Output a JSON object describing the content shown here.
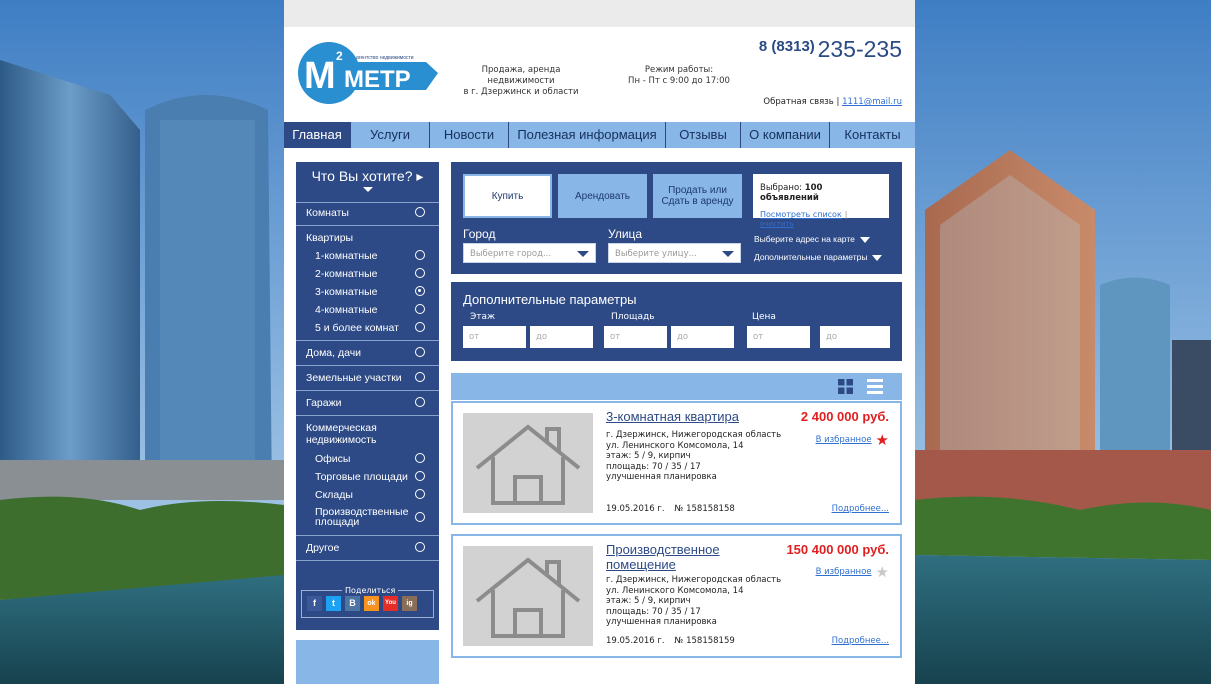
{
  "header": {
    "logo_text": "МЕТР",
    "logo_sup": "2",
    "logo_caption": "агентство недвижимости",
    "tagline": [
      "Продажа, аренда недвижимости",
      "в г. Дзержинск и области"
    ],
    "hours": [
      "Режим работы:",
      "Пн - Пт с 9:00 до 17:00"
    ],
    "phone_code": "8 (8313)",
    "phone_number": "235-235",
    "feedback_label": "Обратная связь |",
    "feedback_email": "1111@mail.ru"
  },
  "nav": {
    "items": [
      "Главная",
      "Услуги",
      "Новости",
      "Полезная информация",
      "Отзывы",
      "О компании",
      "Контакты"
    ],
    "active": "Главная"
  },
  "sidebar": {
    "title": "Что Вы хотите?",
    "komnaty": "Комнаты",
    "kvartiry": "Квартиры",
    "k1": "1-комнатные",
    "k2": "2-комнатные",
    "k3": "3-комнатные",
    "k4": "4-комнатные",
    "k5": "5 и более комнат",
    "doma": "Дома, дачи",
    "zemlya": "Земельные участки",
    "garazhi": "Гаражи",
    "kommercheskaya": "Коммерческая недвижимость",
    "ofisy": "Офисы",
    "torg": "Торговые площади",
    "sklady": "Склады",
    "proizv": "Производственные площади",
    "drugoe": "Другое",
    "selected": "3-комнатные",
    "share_label": "Поделиться",
    "social": [
      "f",
      "t",
      "B",
      "ok",
      "You",
      "ig"
    ]
  },
  "search": {
    "buy": "Купить",
    "rent": "Арендовать",
    "sell": "Продать или Сдать в аренду",
    "selected_prefix": "Выбрано: ",
    "selected_count": "100 объявлений",
    "view_list": "Посмотреть список",
    "clear": "очистить",
    "city_label": "Город",
    "city_placeholder": "Выберите город...",
    "street_label": "Улица",
    "street_placeholder": "Выберите улицу...",
    "map_link": "Выберите адрес на карте",
    "more_params_link": "Дополнительные параметры"
  },
  "params": {
    "title": "Дополнительные параметры",
    "floor": "Этаж",
    "area": "Площадь",
    "price": "Цена",
    "from": "от",
    "to": "до"
  },
  "listings": [
    {
      "title": "3-комнатная квартира",
      "price": "2 400 000 руб.",
      "favorite_label": "В избранное",
      "favorited": true,
      "lines": [
        "г. Дзержинск, Нижегородская область",
        "ул. Ленинского Комсомола, 14",
        "этаж: 5 / 9, кирпич",
        "площадь: 70 / 35 / 17",
        "улучшенная планировка"
      ],
      "date": "19.05.2016 г.",
      "number": "№ 158158158",
      "more": "Подробнее..."
    },
    {
      "title": "Производственное помещение",
      "price": "150 400 000 руб.",
      "favorite_label": "В избранное",
      "favorited": false,
      "lines": [
        "г. Дзержинск, Нижегородская область",
        "ул. Ленинского Комсомола, 14",
        "этаж: 5 / 9, кирпич",
        "площадь: 70 / 35 / 17",
        "улучшенная планировка"
      ],
      "date": "19.05.2016 г.",
      "number": "№ 158158159",
      "more": "Подробнее..."
    }
  ],
  "colors": {
    "primary_dark": "#2d4a86",
    "primary_light": "#87b6e7",
    "price_red": "#e02020",
    "link_blue": "#2f6fd0"
  }
}
